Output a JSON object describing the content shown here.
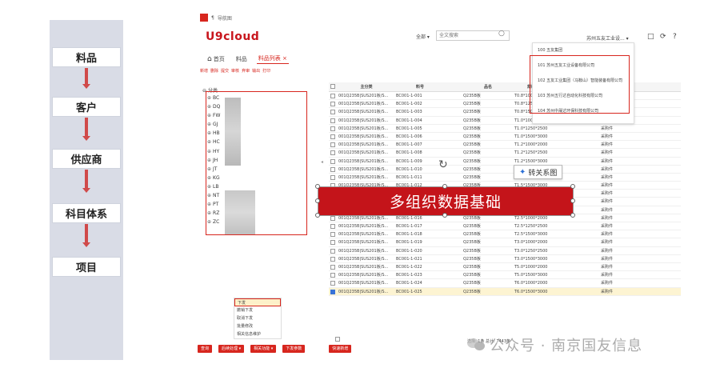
{
  "flow": {
    "steps": [
      "料品",
      "客户",
      "供应商",
      "科目体系",
      "项目"
    ],
    "arrow_color": "#d04a4a"
  },
  "app": {
    "titlebar": {
      "logo_letter": "",
      "text": "导航图"
    },
    "brand": "U9cloud",
    "search": {
      "scope": "全部",
      "placeholder": "全文搜索"
    },
    "org_selector": "苏州五友工业设...",
    "tabs": [
      {
        "label": "首页",
        "icon": "home-icon"
      },
      {
        "label": "料品"
      },
      {
        "label": "料品列表",
        "active": true,
        "closable": true
      }
    ],
    "actions": [
      "新增",
      "删除",
      "提交",
      "审核",
      "弃审",
      "输出",
      "打印"
    ],
    "tree": {
      "label": "分类",
      "items": [
        "BC",
        "DQ",
        "FW",
        "GJ",
        "HB",
        "HC",
        "HY",
        "JH",
        "JT",
        "KG",
        "LB",
        "NT",
        "PT",
        "RZ",
        "ZC"
      ]
    },
    "context_menu": [
      "下发",
      "撤销下发",
      "取消下发",
      "批量修改",
      "相关信息维护"
    ],
    "bottom_buttons": [
      "查询",
      "后续处理",
      "相关功能",
      "下发参数",
      "快速新增"
    ],
    "grid": {
      "headers": {
        "category": "主分类",
        "code": "料号",
        "name": "品名",
        "spec": "规格",
        "attr": "属性"
      },
      "rows": [
        {
          "category": "001Q235B|SUS201板/S...",
          "code": "BC001-1-001",
          "name": "Q235B板",
          "spec": "T0.8*1000*2000",
          "attr": ""
        },
        {
          "category": "001Q235B|SUS201板/S...",
          "code": "BC001-1-002",
          "name": "Q235B板",
          "spec": "T0.8*1250*2500",
          "attr": ""
        },
        {
          "category": "001Q235B|SUS201板/S...",
          "code": "BC001-1-003",
          "name": "Q235B板",
          "spec": "T0.8*1500*3000",
          "attr": ""
        },
        {
          "category": "001Q235B|SUS201板/S...",
          "code": "BC001-1-004",
          "name": "Q235B板",
          "spec": "T1.0*1000*2000",
          "attr": "采购件"
        },
        {
          "category": "001Q235B|SUS201板/S...",
          "code": "BC001-1-005",
          "name": "Q235B板",
          "spec": "T1.0*1250*2500",
          "attr": "采购件"
        },
        {
          "category": "001Q235B|SUS201板/S...",
          "code": "BC001-1-006",
          "name": "Q235B板",
          "spec": "T1.0*1500*3000",
          "attr": "采购件"
        },
        {
          "category": "001Q235B|SUS201板/S...",
          "code": "BC001-1-007",
          "name": "Q235B板",
          "spec": "T1.2*1000*2000",
          "attr": "采购件"
        },
        {
          "category": "001Q235B|SUS201板/S...",
          "code": "BC001-1-008",
          "name": "Q235B板",
          "spec": "T1.2*1250*2500",
          "attr": "采购件"
        },
        {
          "category": "001Q235B|SUS201板/S...",
          "code": "BC001-1-009",
          "name": "Q235B板",
          "spec": "T1.2*1500*3000",
          "attr": "采购件"
        },
        {
          "category": "001Q235B|SUS201板/S...",
          "code": "BC001-1-010",
          "name": "Q235B板",
          "spec": "T1.5*1000*2000",
          "attr": "采购件"
        },
        {
          "category": "001Q235B|SUS201板/S...",
          "code": "BC001-1-011",
          "name": "Q235B板",
          "spec": "T1.5*1250*2500",
          "attr": "采购件"
        },
        {
          "category": "001Q235B|SUS201板/S...",
          "code": "BC001-1-012",
          "name": "Q235B板",
          "spec": "T1.5*1500*3000",
          "attr": "采购件"
        },
        {
          "category": "001Q235B|SUS201板/S...",
          "code": "BC001-1-013",
          "name": "Q235B板",
          "spec": "T2.0*1000*2000",
          "attr": "采购件"
        },
        {
          "category": "001Q235B|SUS201板/S...",
          "code": "BC001-1-014",
          "name": "Q235B板",
          "spec": "T2.0*1250*2500",
          "attr": "采购件"
        },
        {
          "category": "001Q235B|SUS201板/S...",
          "code": "BC001-1-015",
          "name": "Q235B板",
          "spec": "T2.0*1500*3000",
          "attr": "采购件"
        },
        {
          "category": "001Q235B|SUS201板/S...",
          "code": "BC001-1-016",
          "name": "Q235B板",
          "spec": "T2.5*1000*2000",
          "attr": "采购件"
        },
        {
          "category": "001Q235B|SUS201板/S...",
          "code": "BC001-1-017",
          "name": "Q235B板",
          "spec": "T2.5*1250*2500",
          "attr": "采购件"
        },
        {
          "category": "001Q235B|SUS201板/S...",
          "code": "BC001-1-018",
          "name": "Q235B板",
          "spec": "T2.5*1500*3000",
          "attr": "采购件"
        },
        {
          "category": "001Q235B|SUS201板/S...",
          "code": "BC001-1-019",
          "name": "Q235B板",
          "spec": "T3.0*1000*2000",
          "attr": "采购件"
        },
        {
          "category": "001Q235B|SUS201板/S...",
          "code": "BC001-1-020",
          "name": "Q235B板",
          "spec": "T3.0*1250*2500",
          "attr": "采购件"
        },
        {
          "category": "001Q235B|SUS201板/S...",
          "code": "BC001-1-021",
          "name": "Q235B板",
          "spec": "T3.0*1500*3000",
          "attr": "采购件"
        },
        {
          "category": "001Q235B|SUS201板/S...",
          "code": "BC001-1-022",
          "name": "Q235B板",
          "spec": "T5.0*1000*2000",
          "attr": "采购件"
        },
        {
          "category": "001Q235B|SUS201板/S...",
          "code": "BC001-1-023",
          "name": "Q235B板",
          "spec": "T5.0*1500*3000",
          "attr": "采购件"
        },
        {
          "category": "001Q235B|SUS201板/S...",
          "code": "BC001-1-024",
          "name": "Q235B板",
          "spec": "T6.0*1000*2000",
          "attr": "采购件"
        },
        {
          "category": "001Q235B|SUS201板/S...",
          "code": "BC001-1-025",
          "name": "Q235B板",
          "spec": "T6.0*1500*3000",
          "attr": "采购件",
          "selected": true
        }
      ],
      "footer": "选择: 1条    总计: 7443条"
    },
    "org_dropdown": [
      "100  五友集团",
      "101  苏州五友工业设备有限公司",
      "102  五友工业集团（马鞍山）智能装备有限公司",
      "103  苏州五行达自动化科技有限公司",
      "104  苏州中晟达环保科技有限公司"
    ]
  },
  "overlay": {
    "banner": "多组织数据基础",
    "tooltip": "转关系图",
    "watermark": "公众号 · 南京国友信息"
  },
  "colors": {
    "brand": "#c8161d",
    "accent": "#d7261e",
    "banner": "#c4141a",
    "flow_bg": "#d9dce6"
  }
}
